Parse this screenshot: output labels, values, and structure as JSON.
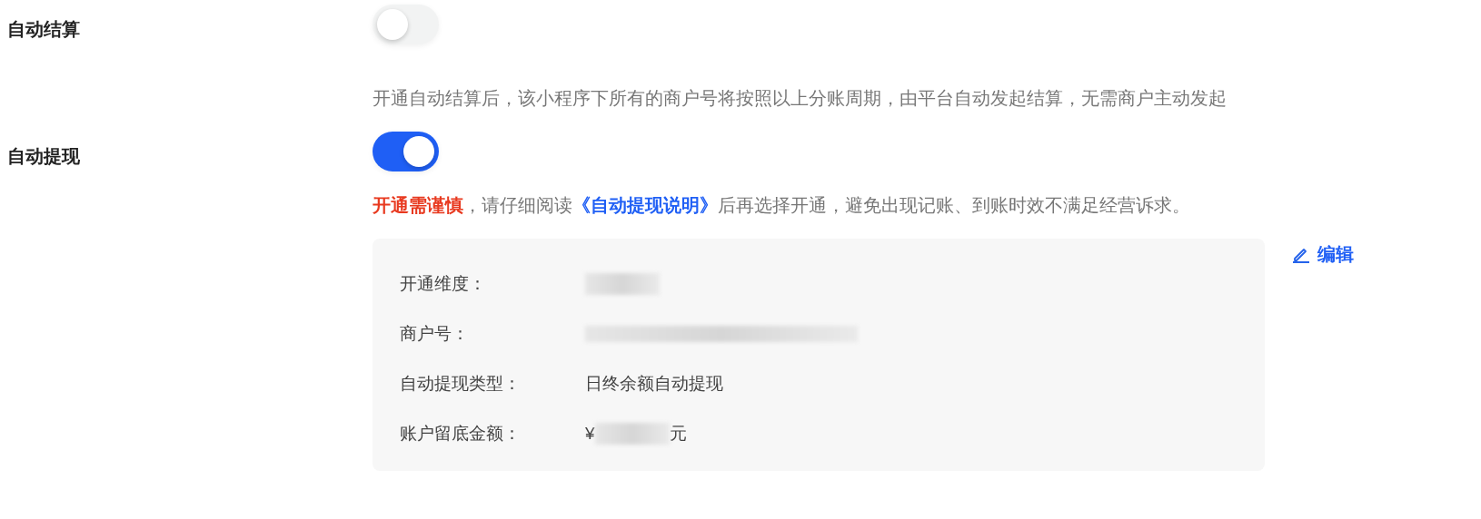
{
  "settings": [
    {
      "label": "自动结算",
      "on": false,
      "description": [
        {
          "kind": "plain",
          "text": "开通自动结算后，该小程序下所有的商户号将按照以上分账周期，由平台自动发起结算，无需商户主动发起"
        }
      ]
    },
    {
      "label": "自动提现",
      "on": true,
      "description": [
        {
          "kind": "warning",
          "text": "开通需谨慎"
        },
        {
          "kind": "plain",
          "text": "，请仔细阅读"
        },
        {
          "kind": "link",
          "text": "《自动提现说明》"
        },
        {
          "kind": "plain",
          "text": "后再选择开通，避免出现记账、到账时效不满足经营诉求。"
        }
      ],
      "details": {
        "fields": [
          {
            "label": "开通维度：",
            "blurred": true
          },
          {
            "label": "商户号：",
            "blurred": true
          },
          {
            "label": "自动提现类型：",
            "value": "日终余额自动提现",
            "blurred": false
          },
          {
            "label": "账户留底金额：",
            "prefix": "¥",
            "suffix": "元",
            "blurred": true
          }
        ],
        "edit": "编辑"
      }
    }
  ]
}
